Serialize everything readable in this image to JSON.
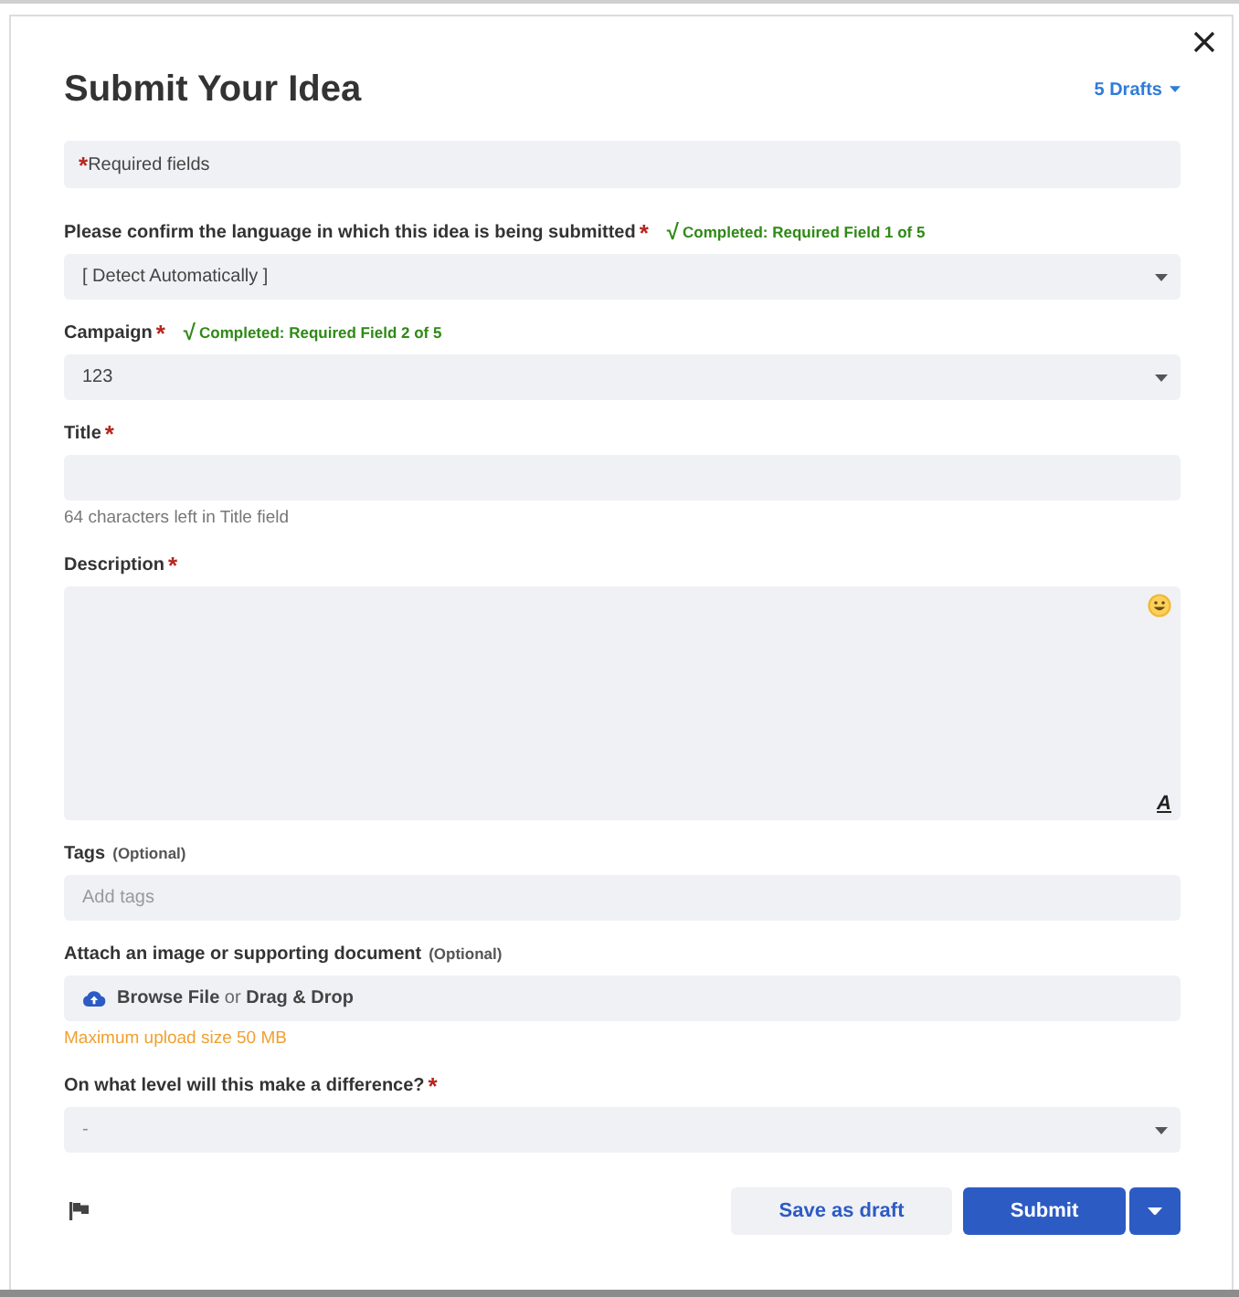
{
  "dialog": {
    "title": "Submit Your Idea",
    "drafts_menu": {
      "label": "5 Drafts"
    }
  },
  "required_note": {
    "mark": "*",
    "text": "Required fields"
  },
  "fields": [
    {
      "kind": "select",
      "label": "Please confirm the language in which this idea is being submitted",
      "required_mark": "*",
      "status": {
        "mark": "√",
        "text": "Completed: Required Field 1 of 5"
      },
      "value": "[ Detect Automatically ]"
    },
    {
      "kind": "select",
      "label": "Campaign",
      "required_mark": "*",
      "status": {
        "mark": "√",
        "text": "Completed: Required Field 2 of 5"
      },
      "value": "123"
    },
    {
      "kind": "text",
      "label": "Title",
      "required_mark": "*",
      "hint": "64 characters left in Title field"
    },
    {
      "kind": "textarea",
      "label": "Description",
      "required_mark": "*",
      "format_button": "A"
    },
    {
      "kind": "text",
      "label": "Tags",
      "optional": "(Optional)",
      "placeholder": "Add tags"
    },
    {
      "kind": "upload",
      "label": "Attach an image or supporting document",
      "optional": "(Optional)",
      "drop_text": "**Browse File** or **Drag & Drop**",
      "hint": "Maximum upload size 50 MB"
    },
    {
      "kind": "select",
      "label": "On what level will this make a difference?",
      "required_mark": "*",
      "placeholder": "-"
    }
  ],
  "footer": {
    "buttons": [
      {
        "kind": "secondary",
        "label": "Save as draft"
      },
      {
        "kind": "primary",
        "label": "Submit",
        "has_menu": true
      }
    ]
  }
}
